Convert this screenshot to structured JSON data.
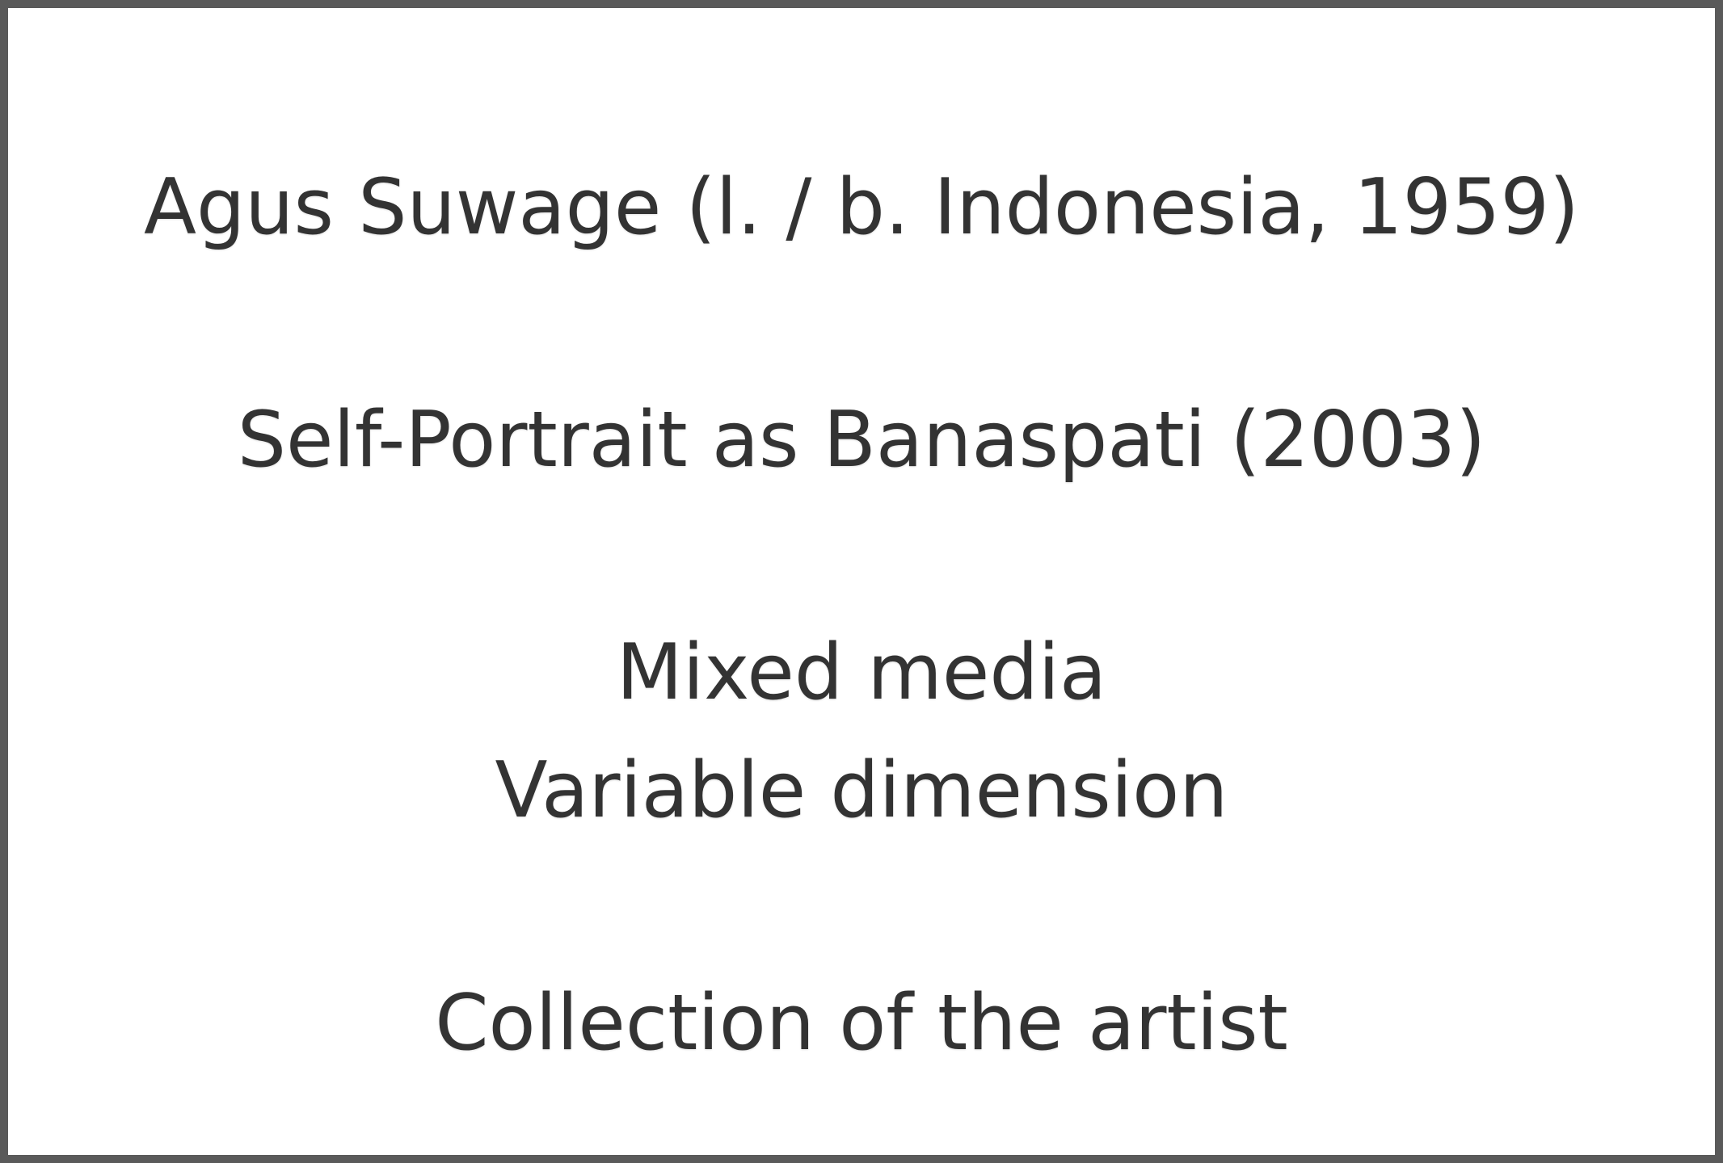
{
  "artwork_label": {
    "artist": "Agus Suwage (l. / b. Indonesia, 1959)",
    "title": "Self-Portrait as Banaspati (2003)",
    "medium": "Mixed media",
    "dimensions": "Variable dimension",
    "credit": "Collection of the artist"
  },
  "colors": {
    "text": "#333333",
    "border": "#5a5a5a",
    "background": "#ffffff"
  }
}
